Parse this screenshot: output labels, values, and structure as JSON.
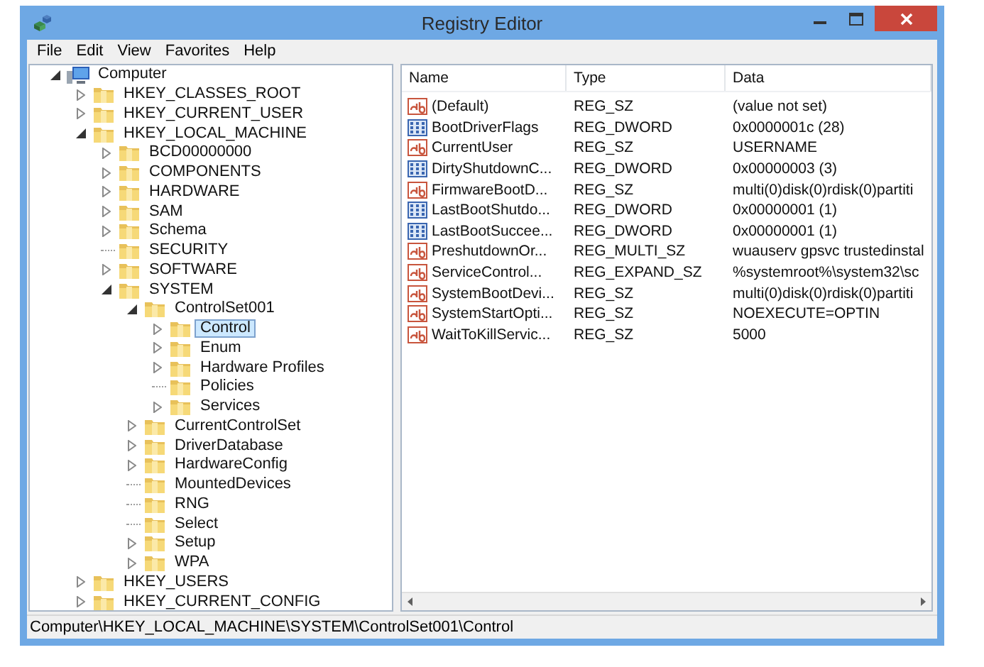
{
  "window": {
    "title": "Registry Editor"
  },
  "menu": [
    "File",
    "Edit",
    "View",
    "Favorites",
    "Help"
  ],
  "tree": [
    {
      "label": "Computer",
      "kind": "computer",
      "expanded": true,
      "selected": false,
      "children": [
        {
          "label": "HKEY_CLASSES_ROOT",
          "kind": "folder",
          "expanded": false,
          "selected": false
        },
        {
          "label": "HKEY_CURRENT_USER",
          "kind": "folder",
          "expanded": false,
          "selected": false
        },
        {
          "label": "HKEY_LOCAL_MACHINE",
          "kind": "folder",
          "expanded": true,
          "selected": false,
          "children": [
            {
              "label": "BCD00000000",
              "kind": "folder",
              "expanded": false,
              "selected": false
            },
            {
              "label": "COMPONENTS",
              "kind": "folder",
              "expanded": false,
              "selected": false
            },
            {
              "label": "HARDWARE",
              "kind": "folder",
              "expanded": false,
              "selected": false
            },
            {
              "label": "SAM",
              "kind": "folder",
              "expanded": false,
              "selected": false
            },
            {
              "label": "Schema",
              "kind": "folder",
              "expanded": false,
              "selected": false
            },
            {
              "label": "SECURITY",
              "kind": "folder",
              "selected": false
            },
            {
              "label": "SOFTWARE",
              "kind": "folder",
              "expanded": false,
              "selected": false
            },
            {
              "label": "SYSTEM",
              "kind": "folder",
              "expanded": true,
              "selected": false,
              "children": [
                {
                  "label": "ControlSet001",
                  "kind": "folder",
                  "expanded": true,
                  "selected": false,
                  "children": [
                    {
                      "label": "Control",
                      "kind": "folder",
                      "expanded": false,
                      "selected": true
                    },
                    {
                      "label": "Enum",
                      "kind": "folder",
                      "expanded": false,
                      "selected": false
                    },
                    {
                      "label": "Hardware Profiles",
                      "kind": "folder",
                      "expanded": false,
                      "selected": false
                    },
                    {
                      "label": "Policies",
                      "kind": "folder",
                      "selected": false
                    },
                    {
                      "label": "Services",
                      "kind": "folder",
                      "expanded": false,
                      "selected": false
                    }
                  ]
                },
                {
                  "label": "CurrentControlSet",
                  "kind": "folder",
                  "expanded": false,
                  "selected": false
                },
                {
                  "label": "DriverDatabase",
                  "kind": "folder",
                  "expanded": false,
                  "selected": false
                },
                {
                  "label": "HardwareConfig",
                  "kind": "folder",
                  "expanded": false,
                  "selected": false
                },
                {
                  "label": "MountedDevices",
                  "kind": "folder",
                  "selected": false
                },
                {
                  "label": "RNG",
                  "kind": "folder",
                  "selected": false
                },
                {
                  "label": "Select",
                  "kind": "folder",
                  "selected": false
                },
                {
                  "label": "Setup",
                  "kind": "folder",
                  "expanded": false,
                  "selected": false
                },
                {
                  "label": "WPA",
                  "kind": "folder",
                  "expanded": false,
                  "selected": false
                }
              ]
            }
          ]
        },
        {
          "label": "HKEY_USERS",
          "kind": "folder",
          "expanded": false,
          "selected": false
        },
        {
          "label": "HKEY_CURRENT_CONFIG",
          "kind": "folder",
          "expanded": false,
          "selected": false
        }
      ]
    }
  ],
  "values": {
    "columns": [
      "Name",
      "Type",
      "Data"
    ],
    "rows": [
      {
        "kind": "string",
        "name": "(Default)",
        "type": "REG_SZ",
        "data": "(value not set)"
      },
      {
        "kind": "binary",
        "name": "BootDriverFlags",
        "type": "REG_DWORD",
        "data": "0x0000001c (28)"
      },
      {
        "kind": "string",
        "name": "CurrentUser",
        "type": "REG_SZ",
        "data": "USERNAME"
      },
      {
        "kind": "binary",
        "name": "DirtyShutdownC...",
        "type": "REG_DWORD",
        "data": "0x00000003 (3)"
      },
      {
        "kind": "string",
        "name": "FirmwareBootD...",
        "type": "REG_SZ",
        "data": "multi(0)disk(0)rdisk(0)partiti"
      },
      {
        "kind": "binary",
        "name": "LastBootShutdo...",
        "type": "REG_DWORD",
        "data": "0x00000001 (1)"
      },
      {
        "kind": "binary",
        "name": "LastBootSuccee...",
        "type": "REG_DWORD",
        "data": "0x00000001 (1)"
      },
      {
        "kind": "string",
        "name": "PreshutdownOr...",
        "type": "REG_MULTI_SZ",
        "data": "wuauserv gpsvc trustedinstal"
      },
      {
        "kind": "string",
        "name": "ServiceControl...",
        "type": "REG_EXPAND_SZ",
        "data": "%systemroot%\\system32\\sc"
      },
      {
        "kind": "string",
        "name": "SystemBootDevi...",
        "type": "REG_SZ",
        "data": "multi(0)disk(0)rdisk(0)partiti"
      },
      {
        "kind": "string",
        "name": "SystemStartOpti...",
        "type": "REG_SZ",
        "data": "NOEXECUTE=OPTIN"
      },
      {
        "kind": "string",
        "name": "WaitToKillServic...",
        "type": "REG_SZ",
        "data": "5000"
      }
    ]
  },
  "status_bar": "Computer\\HKEY_LOCAL_MACHINE\\SYSTEM\\ControlSet001\\Control"
}
